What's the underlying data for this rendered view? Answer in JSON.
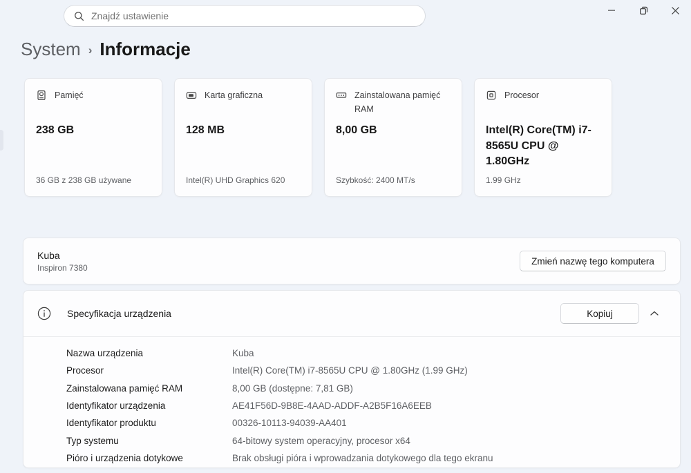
{
  "window": {
    "search_placeholder": "Znajdź ustawienie",
    "controls": {
      "minimize": "minimize",
      "restore": "restore",
      "close": "close"
    }
  },
  "breadcrumb": {
    "parent": "System",
    "separator": "›",
    "current": "Informacje"
  },
  "cards": [
    {
      "icon": "hard-drive-icon",
      "label": "Pamięć",
      "value": "238 GB",
      "footer": "36 GB z 238 GB używane"
    },
    {
      "icon": "gpu-icon",
      "label": "Karta graficzna",
      "value": "128 MB",
      "footer": "Intel(R) UHD Graphics 620"
    },
    {
      "icon": "ram-icon",
      "label": "Zainstalowana pamięć RAM",
      "value": "8,00 GB",
      "footer": "Szybkość: 2400 MT/s"
    },
    {
      "icon": "cpu-icon",
      "label": "Procesor",
      "value": "Intel(R) Core(TM) i7-8565U CPU @ 1.80GHz",
      "footer": "1.99 GHz"
    }
  ],
  "device_panel": {
    "name": "Kuba",
    "model": "Inspiron 7380",
    "rename_button": "Zmień nazwę tego komputera"
  },
  "spec_panel": {
    "icon": "info-icon",
    "title": "Specyfikacja urządzenia",
    "copy_button": "Kopiuj",
    "expander_icon": "chevron-up-icon",
    "rows": [
      {
        "label": "Nazwa urządzenia",
        "value": "Kuba"
      },
      {
        "label": "Procesor",
        "value": "Intel(R) Core(TM) i7-8565U CPU @ 1.80GHz (1.99 GHz)"
      },
      {
        "label": "Zainstalowana pamięć RAM",
        "value": "8,00 GB (dostępne: 7,81 GB)"
      },
      {
        "label": "Identyfikator urządzenia",
        "value": "AE41F56D-9B8E-4AAD-ADDF-A2B5F16A6EEB"
      },
      {
        "label": "Identyfikator produktu",
        "value": "00326-10113-94039-AA401"
      },
      {
        "label": "Typ systemu",
        "value": "64-bitowy system operacyjny, procesor x64"
      },
      {
        "label": "Pióro i urządzenia dotykowe",
        "value": "Brak obsługi pióra i wprowadzania dotykowego dla tego ekranu"
      }
    ]
  },
  "colors": {
    "background": "#eff3f9",
    "panel": "#fdfdfe",
    "border": "#e5e7eb",
    "text_primary": "#1b1b1b",
    "text_secondary": "#5e6064"
  }
}
